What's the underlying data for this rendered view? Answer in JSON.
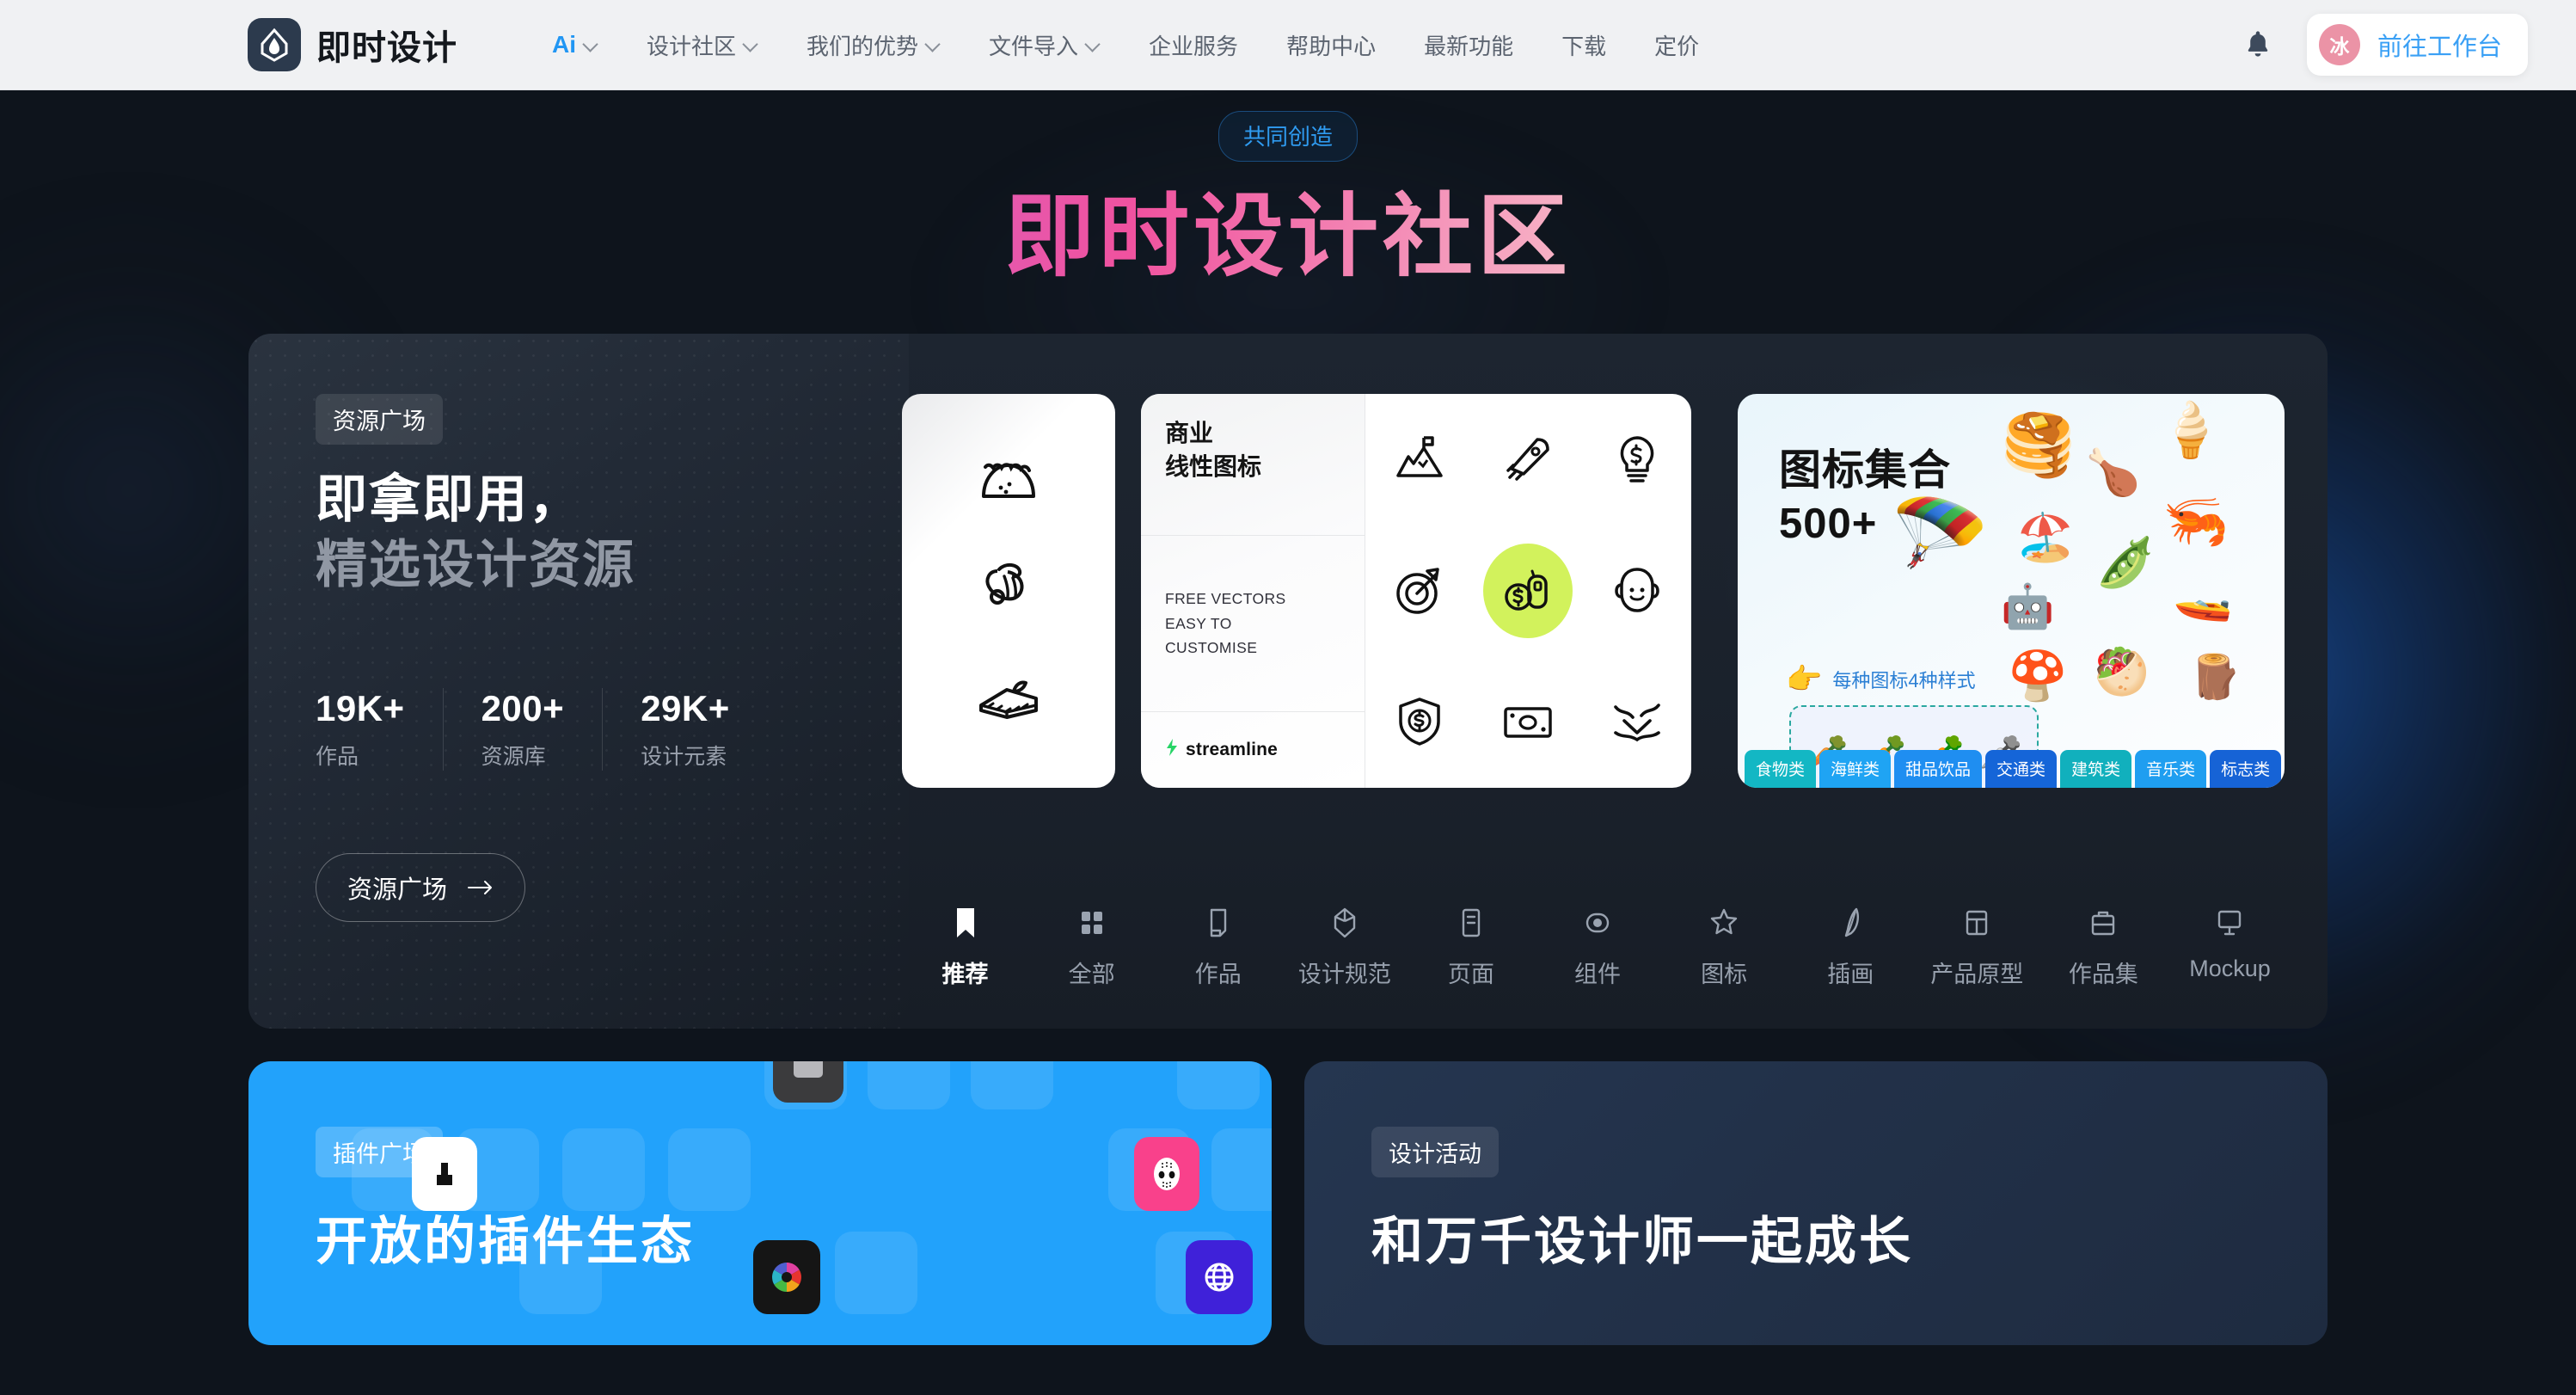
{
  "header": {
    "logo_text": "即时设计",
    "logo_icon": "droplet-logo-icon",
    "nav": [
      {
        "label": "Ai",
        "has_dropdown": true,
        "accent": true
      },
      {
        "label": "设计社区",
        "has_dropdown": true
      },
      {
        "label": "我们的优势",
        "has_dropdown": true
      },
      {
        "label": "文件导入",
        "has_dropdown": true
      },
      {
        "label": "企业服务",
        "has_dropdown": false
      },
      {
        "label": "帮助中心",
        "has_dropdown": false
      },
      {
        "label": "最新功能",
        "has_dropdown": false
      },
      {
        "label": "下载",
        "has_dropdown": false
      },
      {
        "label": "定价",
        "has_dropdown": false
      }
    ],
    "notification_icon": "bell-icon",
    "workbench": {
      "avatar_text": "冰",
      "label": "前往工作台",
      "avatar_color": "#eb93a6",
      "label_color": "#3aa0f5"
    }
  },
  "hero": {
    "pill": "共同创造",
    "title": "即时设计社区"
  },
  "promo": {
    "tag": "资源广场",
    "line1": "即拿即用，",
    "line2": "精选设计资源",
    "stats": [
      {
        "value": "19K+",
        "label": "作品"
      },
      {
        "value": "200+",
        "label": "资源库"
      },
      {
        "value": "29K+",
        "label": "设计元素"
      }
    ],
    "button": "资源广场",
    "button_icon": "arrow-right-icon"
  },
  "showcase": {
    "food_card": {
      "icons": [
        "taco-icon",
        "shrimp-icon",
        "cake-slice-icon"
      ]
    },
    "line_card": {
      "title_line1": "商业",
      "title_line2": "线性图标",
      "subtitle_line1": "FREE VECTORS",
      "subtitle_line2": "EASY TO",
      "subtitle_line3": "CUSTOMISE",
      "brand": "streamline",
      "brand_icon": "streamline-bolt-icon",
      "icons": [
        "mountain-flag-icon",
        "rocket-icon",
        "lightbulb-dollar-icon",
        "target-arrow-icon",
        "money-phone-icon",
        "headset-support-icon",
        "shield-dollar-icon",
        "banknote-icon",
        "chart-trend-icon"
      ],
      "highlight_index": 4,
      "highlight_color": "#d2f25c"
    },
    "icons3d_card": {
      "title_line1": "图标集合",
      "title_line2": "500+",
      "hint": "每种图标4种样式",
      "hint_icon": "pointing-hand-icon",
      "variant_emojis": [
        "🥕",
        "🥕",
        "🥕",
        "🥕"
      ],
      "art_emojis": [
        "🥞",
        "🍗",
        "🍦",
        "🏖️",
        "🦐",
        "🪂",
        "🫛",
        "🤖",
        "🚤",
        "🍄",
        "🥙",
        "🪵"
      ],
      "chips": [
        {
          "label": "食物类",
          "color": "#13b7c4"
        },
        {
          "label": "海鲜类",
          "color": "#1fa4f3"
        },
        {
          "label": "甜品饮品",
          "color": "#1f8ef1"
        },
        {
          "label": "交通类",
          "color": "#1565d8"
        },
        {
          "label": "建筑类",
          "color": "#11b0bd"
        },
        {
          "label": "音乐类",
          "color": "#1f9ef0"
        },
        {
          "label": "标志类",
          "color": "#1663d6"
        }
      ]
    }
  },
  "tabs": [
    {
      "label": "推荐",
      "icon": "bookmark-icon",
      "active": true
    },
    {
      "label": "全部",
      "icon": "grid-icon",
      "active": false
    },
    {
      "label": "作品",
      "icon": "artboard-icon",
      "active": false
    },
    {
      "label": "设计规范",
      "icon": "cube-icon",
      "active": false
    },
    {
      "label": "页面",
      "icon": "page-icon",
      "active": false
    },
    {
      "label": "组件",
      "icon": "component-icon",
      "active": false
    },
    {
      "label": "图标",
      "icon": "star-icon",
      "active": false
    },
    {
      "label": "插画",
      "icon": "feather-icon",
      "active": false
    },
    {
      "label": "产品原型",
      "icon": "layout-icon",
      "active": false
    },
    {
      "label": "作品集",
      "icon": "briefcase-icon",
      "active": false
    },
    {
      "label": "Mockup",
      "icon": "monitor-icon",
      "active": false
    }
  ],
  "bottom": {
    "plugin_card": {
      "tag": "插件广场",
      "title": "开放的插件生态",
      "bg_color": "#22a2fb"
    },
    "event_card": {
      "tag": "设计活动",
      "title": "和万千设计师一起成长"
    }
  }
}
